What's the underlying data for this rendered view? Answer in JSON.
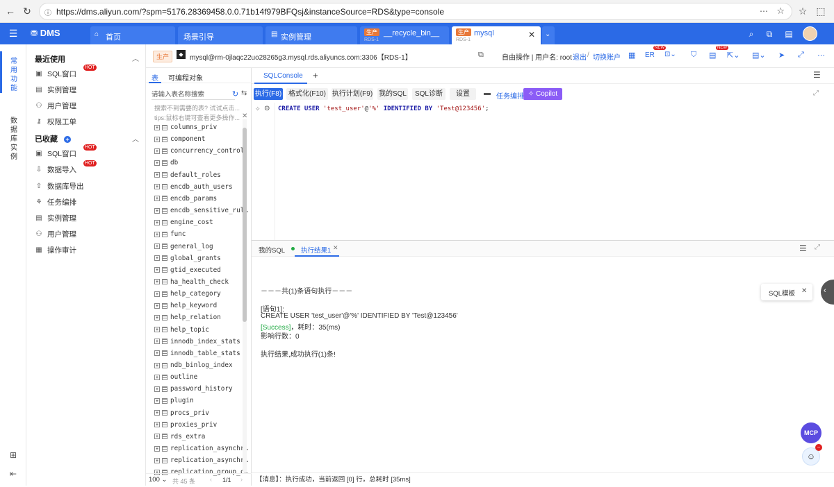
{
  "browser": {
    "url": "https://dms.aliyun.com/?spm=5176.28369458.0.0.71b14f979BFQsj&instanceSource=RDS&type=console"
  },
  "app": {
    "logo": "DMS",
    "tabs": [
      {
        "label": "首页"
      },
      {
        "label": "场景引导"
      },
      {
        "label": "实例管理"
      },
      {
        "label": "__recycle_bin__",
        "tag": "生产",
        "sub": "RDS-1"
      },
      {
        "label": "mysql",
        "tag": "生产",
        "sub": "RDS-1"
      }
    ]
  },
  "rail": {
    "common": "常用功能",
    "db": "数据库实例"
  },
  "menu": {
    "recent_title": "最近使用",
    "recent": [
      {
        "label": "SQL窗口",
        "hot": "HOT"
      },
      {
        "label": "实例管理"
      },
      {
        "label": "用户管理"
      },
      {
        "label": "权限工单"
      }
    ],
    "fav_title": "已收藏",
    "fav": [
      {
        "label": "SQL窗口",
        "hot": "HOT"
      },
      {
        "label": "数据导入",
        "hot": "HOT"
      },
      {
        "label": "数据库导出"
      },
      {
        "label": "任务编排"
      },
      {
        "label": "实例管理"
      },
      {
        "label": "用户管理"
      },
      {
        "label": "操作审计"
      }
    ]
  },
  "conn": {
    "env": "生产",
    "instance": "mysql@rm-0jlaqc22uo28265g3.mysql.rds.aliyuncs.com:3306【RDS-1】",
    "mode": "自由操作 | 用户名: root",
    "logout": "退出",
    "switch": "切换账户",
    "er": "ER",
    "new": "NEW"
  },
  "tree": {
    "tabs": [
      "表",
      "可编程对象"
    ],
    "search_placeholder": "请输入表名称搜索",
    "hint1": "搜索不到需要的表? 试试点击...",
    "hint2": "tips:鼠标右键可查看更多操作...",
    "items": [
      "columns_priv",
      "component",
      "concurrency_control",
      "db",
      "default_roles",
      "encdb_auth_users",
      "encdb_params",
      "encdb_sensitive_rul…",
      "engine_cost",
      "func",
      "general_log",
      "global_grants",
      "gtid_executed",
      "ha_health_check",
      "help_category",
      "help_keyword",
      "help_relation",
      "help_topic",
      "innodb_index_stats",
      "innodb_table_stats",
      "ndb_binlog_index",
      "outline",
      "password_history",
      "plugin",
      "procs_priv",
      "proxies_priv",
      "rds_extra",
      "replication_asynchr…",
      "replication_asynchr…",
      "replication_group_c…"
    ],
    "footer": {
      "size": "100",
      "total": "共 45 条",
      "page": "1/1"
    }
  },
  "editor": {
    "tab": "SQLConsole",
    "buttons": [
      "执行(F8)",
      "格式化(F10)",
      "执行计划(F9)",
      "我的SQL",
      "SQL诊断",
      "设置"
    ],
    "task": "任务编排",
    "copilot": "Copilot",
    "sql": {
      "kw1": "CREATE USER",
      "s1": "'test_user'",
      "at": "@",
      "s2": "'%'",
      "kw2": "IDENTIFIED BY",
      "s3": "'Test@123456'",
      "end": ";"
    }
  },
  "results": {
    "tabs": [
      "我的SQL",
      "执行结果1"
    ],
    "lines": [
      "－－－共(1)条语句执行－－－",
      "",
      "[语句1]:",
      "CREATE USER 'test_user'@'%' IDENTIFIED BY 'Test@123456'",
      "[Success]，耗时：35(ms)",
      "影响行数：0",
      "",
      "执行结果,成功执行(1)条!"
    ],
    "template": "SQL模板",
    "status": "【消息】：执行成功，当前返回 [0] 行，总耗时 [35ms]"
  },
  "mcp": "MCP"
}
